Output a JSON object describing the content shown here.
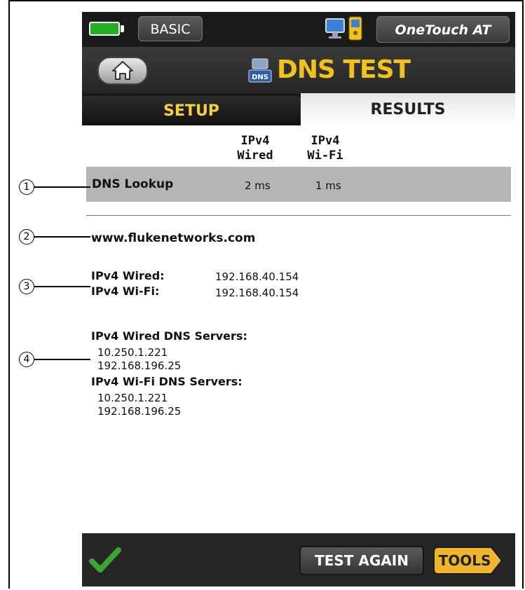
{
  "status_bar": {
    "mode_label": "BASIC",
    "device_name": "OneTouch AT"
  },
  "header": {
    "title": "DNS TEST",
    "title_icon_text": "DNS"
  },
  "tabs": [
    {
      "label": "SETUP"
    },
    {
      "label": "RESULTS"
    }
  ],
  "results_table": {
    "columns": [
      "IPv4\nWired",
      "IPv4\nWi-Fi"
    ],
    "rows": [
      {
        "label": "DNS Lookup",
        "values": [
          "2 ms",
          "1 ms"
        ]
      }
    ]
  },
  "details": {
    "hostname": "www.flukenetworks.com",
    "addresses": [
      {
        "label": "IPv4 Wired:",
        "value": "192.168.40.154"
      },
      {
        "label": "IPv4 Wi-Fi:",
        "value": "192.168.40.154"
      }
    ],
    "dns_server_groups": [
      {
        "label": "IPv4 Wired DNS Servers:",
        "servers": [
          "10.250.1.221",
          "192.168.196.25"
        ]
      },
      {
        "label": "IPv4 Wi-Fi DNS Servers:",
        "servers": [
          "10.250.1.221",
          "192.168.196.25"
        ]
      }
    ]
  },
  "footer": {
    "test_again_label": "TEST AGAIN",
    "tools_label": "TOOLS"
  },
  "callouts": [
    "1",
    "2",
    "3",
    "4"
  ],
  "colors": {
    "title_yellow": "#f2c21b",
    "tab_yellow": "#f2d23a",
    "battery_green": "#22b022",
    "check_green": "#3aa635",
    "tools_orange": "#f0b52a"
  }
}
